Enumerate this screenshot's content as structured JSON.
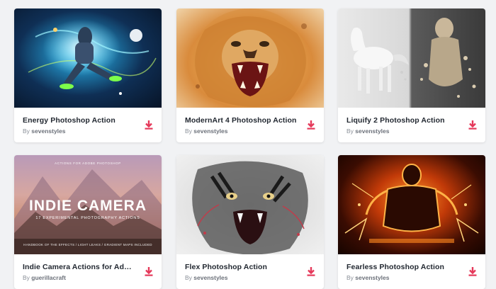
{
  "by_prefix": "By",
  "cards": [
    {
      "title": "Energy Photoshop Action",
      "author": "sevenstyles"
    },
    {
      "title": "ModernArt 4 Photoshop Action",
      "author": "sevenstyles"
    },
    {
      "title": "Liquify 2 Photoshop Action",
      "author": "sevenstyles"
    },
    {
      "title": "Indie Camera Actions for Adobe...",
      "author": "guerillacraft"
    },
    {
      "title": "Flex Photoshop Action",
      "author": "sevenstyles"
    },
    {
      "title": "Fearless Photoshop Action",
      "author": "sevenstyles"
    }
  ],
  "indie_thumb": {
    "kicker": "ACTIONS FOR ADOBE PHOTOSHOP",
    "headline": "INDIE CAMERA",
    "subline": "17 EXPERIMENTAL PHOTOGRAPHY ACTIONS",
    "footer": "HANDBOOK OF THE EFFECTS / LIGHT LEAKS / GRADIENT MAPS INCLUDED"
  },
  "colors": {
    "accent": "#e5395a",
    "title": "#222831",
    "muted": "#8a8f98"
  },
  "icons": {
    "download": "download-icon"
  }
}
